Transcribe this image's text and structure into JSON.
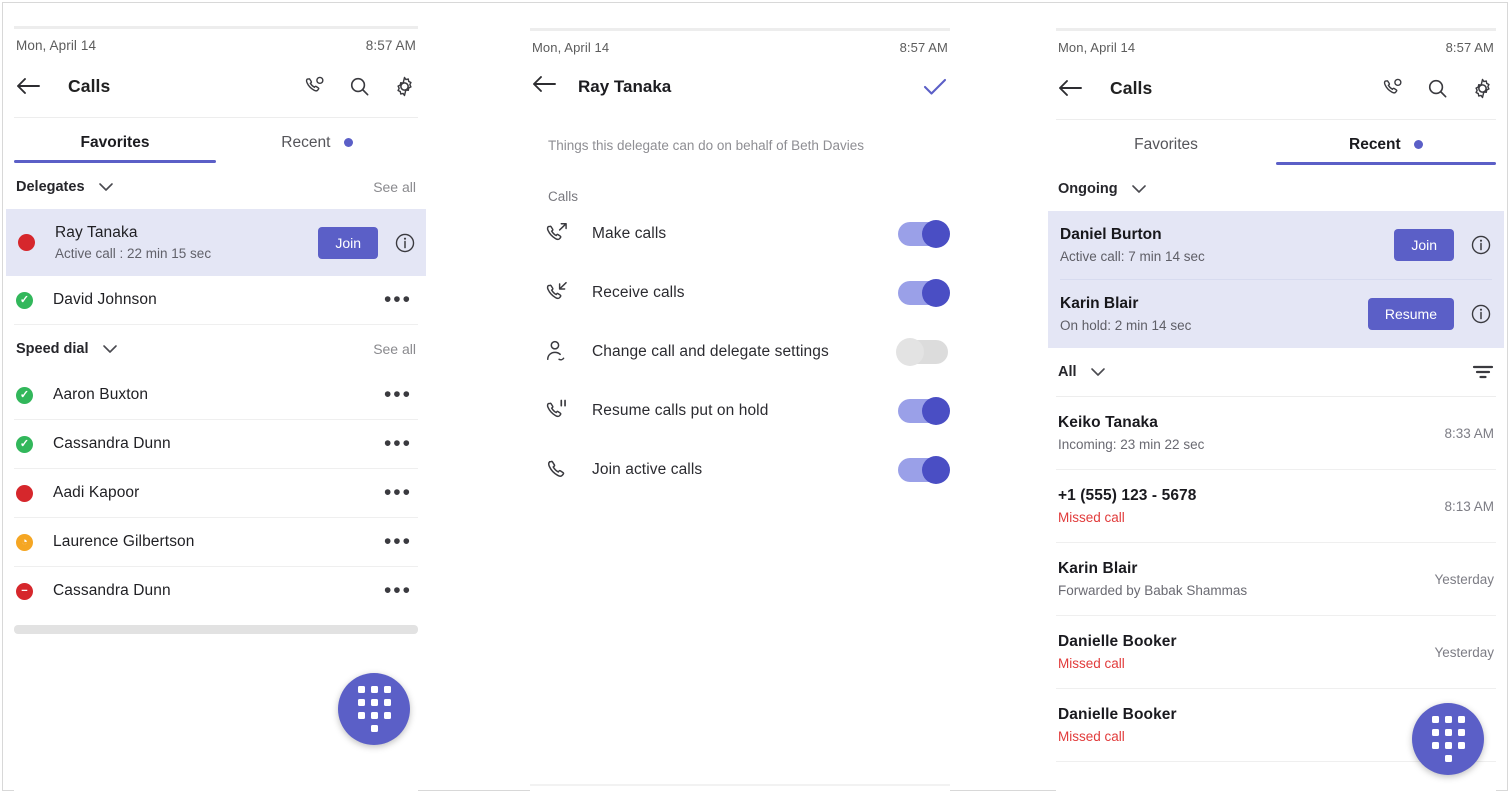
{
  "panel1": {
    "status": {
      "date": "Mon, April 14",
      "time": "8:57 AM"
    },
    "appbar": {
      "title": "Calls",
      "back_label": "Back",
      "icons": [
        "call-person-icon",
        "search-icon",
        "gear-icon"
      ]
    },
    "tabs": [
      {
        "label": "Favorites",
        "active": true,
        "badge": false
      },
      {
        "label": "Recent",
        "active": false,
        "badge": true
      }
    ],
    "delegates_section": {
      "label": "Delegates",
      "see_all": "See all"
    },
    "delegates": [
      {
        "name": "Ray Tanaka",
        "sub": "Active call : 22 min 15 sec",
        "presence": "busy",
        "action": "Join",
        "highlight": true
      },
      {
        "name": "David Johnson",
        "presence": "available",
        "action": "more"
      }
    ],
    "speed_dial_section": {
      "label": "Speed dial",
      "see_all": "See all"
    },
    "speed_dial": [
      {
        "name": "Aaron Buxton",
        "presence": "available"
      },
      {
        "name": "Cassandra Dunn",
        "presence": "available"
      },
      {
        "name": "Aadi Kapoor",
        "presence": "busy"
      },
      {
        "name": "Laurence Gilbertson",
        "presence": "away"
      },
      {
        "name": "Cassandra Dunn",
        "presence": "dnd"
      }
    ]
  },
  "panel2": {
    "status": {
      "date": "Mon, April 14",
      "time": "8:57 AM"
    },
    "appbar": {
      "title": "Ray Tanaka",
      "confirm_label": "Done"
    },
    "description": "Things this delegate can do on behalf of Beth Davies",
    "group_label": "Calls",
    "permissions": [
      {
        "label": "Make calls",
        "icon": "call-outgoing-icon",
        "on": true
      },
      {
        "label": "Receive calls",
        "icon": "call-incoming-icon",
        "on": true
      },
      {
        "label": "Change call and delegate settings",
        "icon": "person-settings-icon",
        "on": false
      },
      {
        "label": "Resume calls put on hold",
        "icon": "call-hold-icon",
        "on": true
      },
      {
        "label": "Join active calls",
        "icon": "call-icon",
        "on": true
      }
    ]
  },
  "panel3": {
    "status": {
      "date": "Mon, April 14",
      "time": "8:57 AM"
    },
    "appbar": {
      "title": "Calls",
      "icons": [
        "call-person-icon",
        "search-icon",
        "gear-icon"
      ]
    },
    "tabs": [
      {
        "label": "Favorites",
        "active": false,
        "badge": false
      },
      {
        "label": "Recent",
        "active": true,
        "badge": true
      }
    ],
    "ongoing_section": {
      "label": "Ongoing"
    },
    "ongoing": [
      {
        "name": "Daniel Burton",
        "sub": "Active call: 7 min 14 sec",
        "action": "Join"
      },
      {
        "name": "Karin Blair",
        "sub": "On hold: 2 min 14 sec",
        "action": "Resume"
      }
    ],
    "filter_section": {
      "label": "All"
    },
    "history": [
      {
        "name": "Keiko Tanaka",
        "sub": "Incoming: 23 min 22 sec",
        "missed": false,
        "time": "8:33 AM"
      },
      {
        "name": "+1 (555) 123 - 5678",
        "sub": "Missed call",
        "missed": true,
        "time": "8:13 AM"
      },
      {
        "name": "Karin Blair",
        "sub": "Forwarded by Babak Shammas",
        "missed": false,
        "time": "Yesterday"
      },
      {
        "name": "Danielle Booker",
        "sub": "Missed call",
        "missed": true,
        "time": "Yesterday"
      },
      {
        "name": "Danielle Booker",
        "sub": "Missed call",
        "missed": true,
        "time": ""
      }
    ]
  },
  "colors": {
    "accent": "#5b5fc7",
    "highlight_bg": "#e4e6f5",
    "available": "#32b75b",
    "busy": "#d6272c",
    "away": "#f5a623",
    "missed": "#e13b3b"
  }
}
